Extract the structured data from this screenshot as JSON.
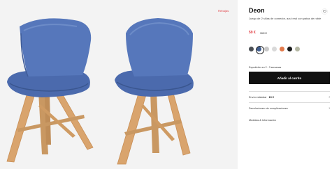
{
  "product": {
    "badge": "Rebajas",
    "title": "Deon",
    "description": "Juego de 2 sillas de comedor, azul real con patas de roble",
    "price": "59 €",
    "old_price": "119 €"
  },
  "colors": {
    "swatches": [
      "#4a4e53",
      "#3f5d8f",
      "#c8c8c8",
      "#d9d9d9",
      "#e27a4b",
      "#1b1b1b",
      "#b4b7a3"
    ],
    "selected_index": 1,
    "chair_blue": "#4c6cb0",
    "wood": "#d8a26b"
  },
  "availability": {
    "shipping_text": "Expedición en 2 - 3 semanas"
  },
  "actions": {
    "add_to_cart": "Añadir al carrito"
  },
  "info_rows": {
    "shipping": {
      "label": "Envío estándar",
      "value": "19 €"
    },
    "returns": {
      "label": "Devoluciones sin complicaciones"
    },
    "measures": {
      "label": "Medidas & Información"
    }
  }
}
